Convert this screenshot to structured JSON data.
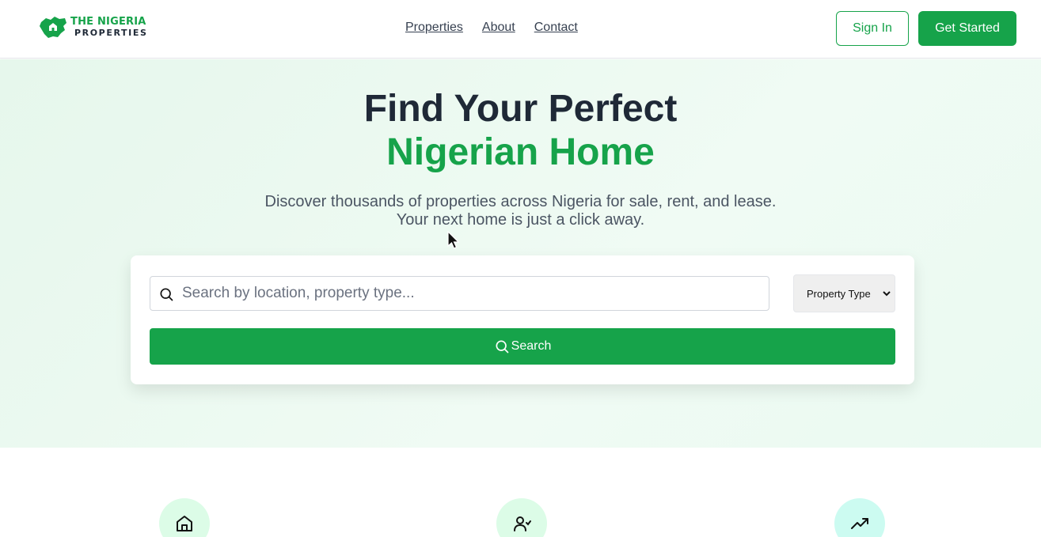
{
  "brand": {
    "line1": "THE NIGERIA",
    "line2": "PROPERTIES",
    "color": "#16a34a"
  },
  "nav": {
    "links": [
      {
        "label": "Properties"
      },
      {
        "label": "About"
      },
      {
        "label": "Contact"
      }
    ]
  },
  "auth": {
    "sign_in_label": "Sign In",
    "get_started_label": "Get Started"
  },
  "hero": {
    "title_line1": "Find Your Perfect",
    "title_line2": "Nigerian Home",
    "subtitle_line1": "Discover thousands of properties across Nigeria for sale, rent, and lease.",
    "subtitle_line2": "Your next home is just a click away."
  },
  "search": {
    "placeholder": "Search by location, property type...",
    "value": "",
    "property_type_selected": "Property Type",
    "button_label": "Search",
    "search_icon": "search-icon"
  },
  "features": [
    {
      "icon": "home-icon"
    },
    {
      "icon": "user-icon"
    },
    {
      "icon": "trending-up-icon"
    }
  ],
  "colors": {
    "primary": "#16a34a",
    "heading": "#1f2937",
    "hero_bg": "#e6f7ec"
  }
}
